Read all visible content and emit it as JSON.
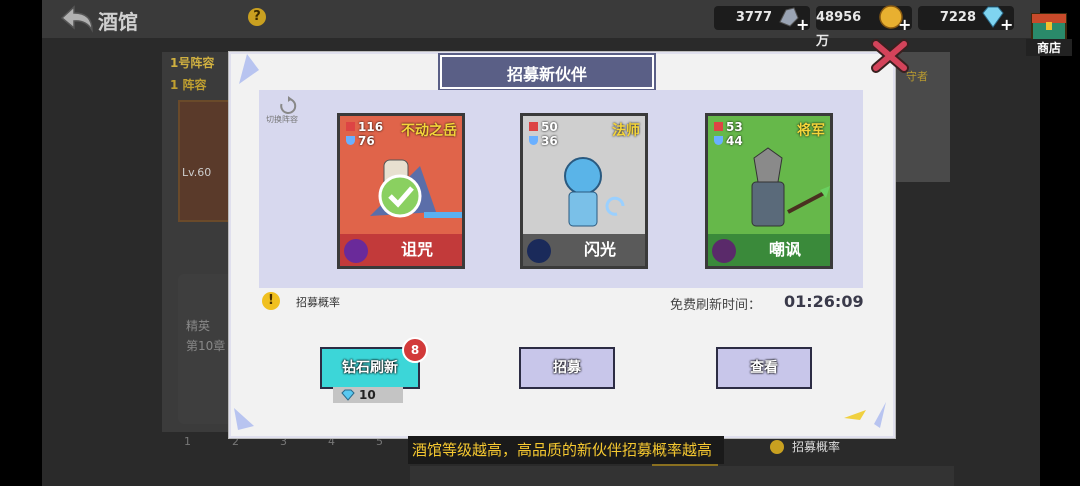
{
  "topbar": {
    "title": "酒馆",
    "help": "?",
    "resources": [
      {
        "value": "3777",
        "icon": "ore-icon"
      },
      {
        "value": "48956万",
        "icon": "coin-icon"
      },
      {
        "value": "7228",
        "icon": "diamond-icon"
      }
    ],
    "shop_label": "商店"
  },
  "background": {
    "lineup_tab": "1号阵容",
    "lineup_sub": "1 阵容",
    "card_level": "Lv.60",
    "elite_text": "精英",
    "elite_sub": "第10章",
    "pages": [
      "1",
      "2",
      "3",
      "4",
      "5"
    ],
    "right_label": "守者",
    "bottom_rate": "招募概率"
  },
  "modal": {
    "title": "招募新伙伴",
    "switch_label": "切换阵容",
    "cards": [
      {
        "atk": "116",
        "def": "76",
        "role": "不动之岳",
        "skill": "诅咒",
        "color": "red"
      },
      {
        "atk": "50",
        "def": "36",
        "role": "法师",
        "skill": "闪光",
        "color": "gray"
      },
      {
        "atk": "53",
        "def": "44",
        "role": "将军",
        "skill": "嘲讽",
        "color": "green"
      }
    ],
    "rate_label": "招募概率",
    "refresh_label": "免费刷新时间：",
    "timer": "01:26:09",
    "buttons": {
      "diamond_refresh": "钻石刷新",
      "badge": "8",
      "cost": "10",
      "recruit": "招募",
      "view": "查看"
    }
  },
  "tip": "酒馆等级越高，高品质的新伙伴招募概率越高"
}
